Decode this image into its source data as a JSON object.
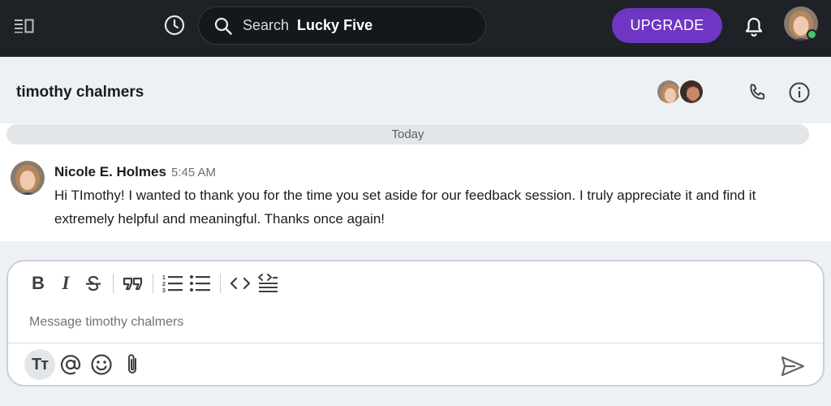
{
  "topbar": {
    "search_prefix": "Search",
    "search_query": "Lucky Five",
    "upgrade_label": "UPGRADE",
    "icons": [
      "menu-icon",
      "history-icon",
      "search-icon",
      "bell-icon"
    ]
  },
  "channel": {
    "title": "timothy chalmers",
    "icons": [
      "phone-icon",
      "info-icon"
    ]
  },
  "messages": {
    "divider": "Today",
    "items": [
      {
        "author": "Nicole E. Holmes",
        "time": "5:45 AM",
        "text": "Hi TImothy! I wanted to thank you for the time you set aside for our feedback session. I truly appreciate it and find it extremely helpful and meaningful. Thanks once again!"
      }
    ]
  },
  "composer": {
    "placeholder": "Message timothy chalmers",
    "value": "",
    "toolbar": {
      "bold": "B",
      "italic": "I",
      "text_format": "Tт"
    }
  },
  "colors": {
    "topbar": "#1e2226",
    "accent": "#6f36c3",
    "presence": "#43c56c"
  }
}
